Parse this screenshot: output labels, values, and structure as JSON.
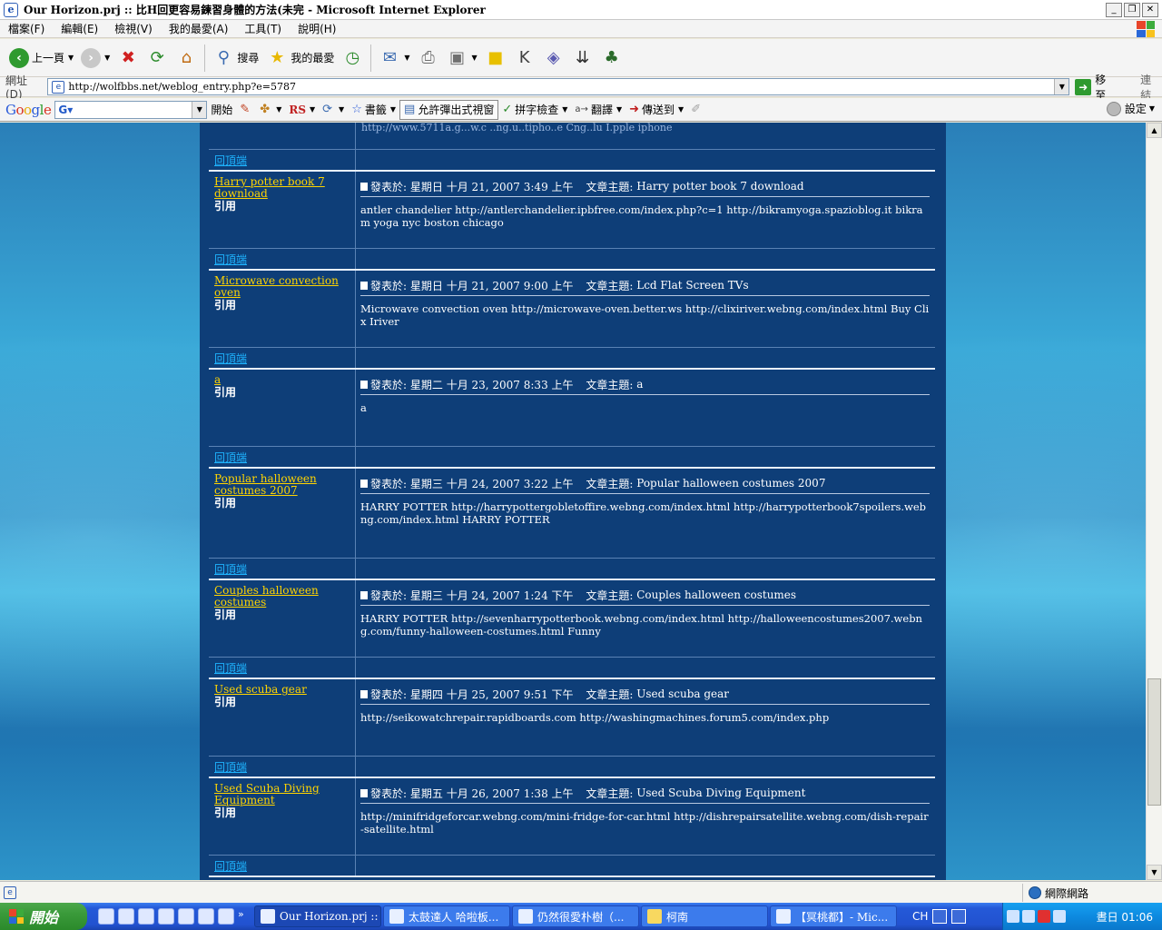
{
  "window": {
    "title": "Our Horizon.prj :: 比H回更容易鍊習身體的方法(未完 - Microsoft Internet Explorer",
    "icon": "ie-icon"
  },
  "menu": [
    "檔案(F)",
    "編輯(E)",
    "檢視(V)",
    "我的最愛(A)",
    "工具(T)",
    "說明(H)"
  ],
  "toolbar": {
    "back_label": "上一頁",
    "search_label": "搜尋",
    "favorites_label": "我的最愛"
  },
  "address": {
    "label": "網址(D)",
    "url": "http://wolfbbs.net/weblog_entry.php?e=5787",
    "go_label": "移至",
    "links_label": "連結"
  },
  "google_bar": {
    "logo": "Google",
    "start_label": "開始",
    "rs_label": "RS",
    "bookmarks_label": "書籤",
    "popup_label": "允許彈出式視窗",
    "spell_label": "拼字檢查",
    "translate_label": "翻譯",
    "send_label": "傳送到",
    "settings_label": "設定"
  },
  "page": {
    "top_stub_text": "http://www.5711a.g...w.c ..ng.u..tipho..e Cng..lu I.pple iphone",
    "back_to_top": "回頂端",
    "quote_label": "引用",
    "posted_prefix": "發表於:",
    "subject_prefix": "文章主題:",
    "posts": [
      {
        "author": "Harry potter book 7 download",
        "date": "星期日 十月 21, 2007 3:49 上午",
        "subject": "Harry potter book 7 download",
        "text": "antler chandelier http://antlerchandelier.ipbfree.com/index.php?c=1 http://bikramyoga.spazioblog.it bikram yoga nyc boston chicago"
      },
      {
        "author": "Microwave convection oven",
        "date": "星期日 十月 21, 2007 9:00 上午",
        "subject": "Lcd Flat Screen TVs",
        "text": "Microwave convection oven http://microwave-oven.better.ws http://clixiriver.webng.com/index.html Buy Clix Iriver"
      },
      {
        "author": "a",
        "date": "星期二 十月 23, 2007 8:33 上午",
        "subject": "a",
        "text": "a"
      },
      {
        "author": "Popular halloween costumes 2007",
        "date": "星期三 十月 24, 2007 3:22 上午",
        "subject": "Popular halloween costumes 2007",
        "text": "HARRY POTTER http://harrypottergobletoffire.webng.com/index.html http://harrypotterbook7spoilers.webng.com/index.html HARRY POTTER"
      },
      {
        "author": "Couples halloween costumes",
        "date": "星期三 十月 24, 2007 1:24 下午",
        "subject": "Couples halloween costumes",
        "text": "HARRY POTTER http://sevenharrypotterbook.webng.com/index.html http://halloweencostumes2007.webng.com/funny-halloween-costumes.html Funny"
      },
      {
        "author": "Used scuba gear",
        "date": "星期四 十月 25, 2007 9:51 下午",
        "subject": "Used scuba gear",
        "text": "http://seikowatchrepair.rapidboards.com http://washingmachines.forum5.com/index.php"
      },
      {
        "author": "Used Scuba Diving Equipment",
        "date": "星期五 十月 26, 2007 1:38 上午",
        "subject": "Used Scuba Diving Equipment",
        "text": "http://minifridgeforcar.webng.com/mini-fridge-for-car.html http://dishrepairsatellite.webng.com/dish-repair-satellite.html"
      }
    ]
  },
  "status": {
    "zone": "網際網路"
  },
  "taskbar": {
    "start": "開始",
    "tasks": [
      "Our Horizon.prj :: ...",
      "太鼓達人 哈啦板...",
      "仍然很愛朴樹（...",
      "柯南",
      "【冥桃都】- Mic..."
    ],
    "lang": "CH",
    "clock": "晝日 01:06"
  },
  "colors": {
    "page_bg": "#0e3e78",
    "author_link": "#ffd400",
    "top_link": "#1eb4ff"
  }
}
